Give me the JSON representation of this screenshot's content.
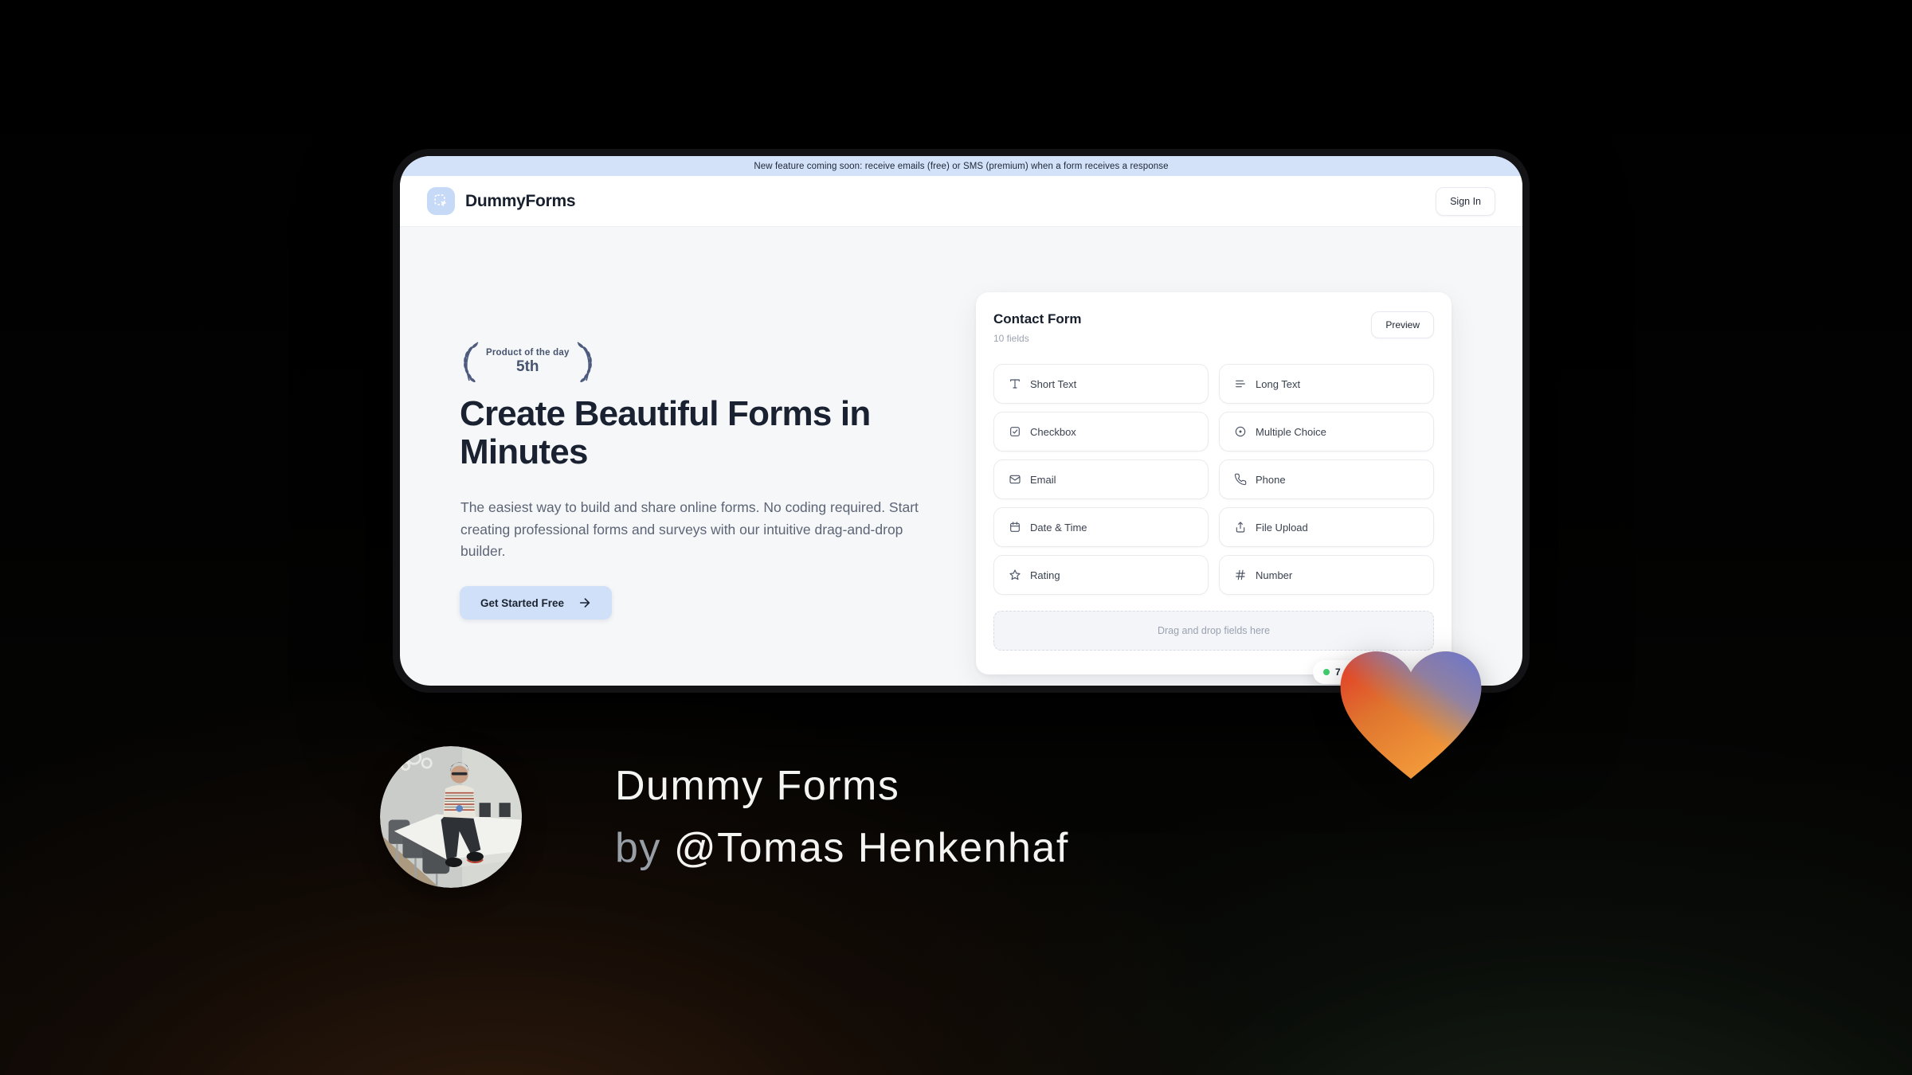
{
  "banner": {
    "text": "New feature coming soon: receive emails (free) or SMS (premium) when a form receives a response"
  },
  "header": {
    "brand": "DummyForms",
    "sign_in_label": "Sign In"
  },
  "hero": {
    "award_badge": {
      "top": "Product of the day",
      "rank": "5th"
    },
    "title_line1": "Create Beautiful Forms in",
    "title_line2": "Minutes",
    "description": "The easiest way to build and share online forms. No coding required. Start creating professional forms and surveys with our intuitive drag-and-drop builder.",
    "cta_label": "Get Started Free"
  },
  "form_card": {
    "title": "Contact Form",
    "subtitle": "10 fields",
    "preview_label": "Preview",
    "fields": [
      {
        "label": "Short Text",
        "icon": "type-icon"
      },
      {
        "label": "Long Text",
        "icon": "align-left-icon"
      },
      {
        "label": "Checkbox",
        "icon": "checkbox-icon"
      },
      {
        "label": "Multiple Choice",
        "icon": "radio-icon"
      },
      {
        "label": "Email",
        "icon": "mail-icon"
      },
      {
        "label": "Phone",
        "icon": "phone-icon"
      },
      {
        "label": "Date & Time",
        "icon": "calendar-icon"
      },
      {
        "label": "File Upload",
        "icon": "upload-icon"
      },
      {
        "label": "Rating",
        "icon": "star-icon"
      },
      {
        "label": "Number",
        "icon": "hash-icon"
      }
    ],
    "dropzone_text": "Drag and drop fields here",
    "responses_badge": {
      "visible_text": "7"
    }
  },
  "outro": {
    "title": "Dummy Forms",
    "byline_prefix": "by",
    "byline_handle": "@Tomas Henkenhaf"
  },
  "colors": {
    "banner_blue": "#d3e1f9",
    "accent_blue": "#cfe0f8",
    "brand_navy": "#1a2232",
    "status_green": "#3ecf6e",
    "heart_red": "#e33b28",
    "heart_orange": "#f5a03c",
    "heart_blue": "#7077c8"
  }
}
